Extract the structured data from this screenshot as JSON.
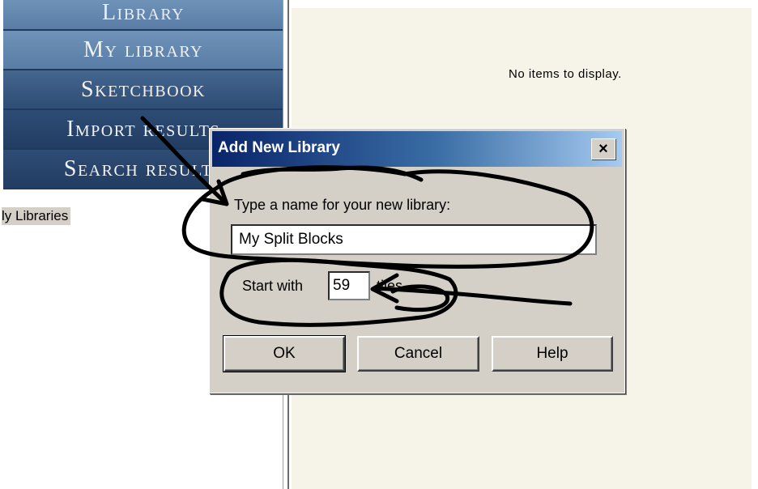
{
  "nav": {
    "items": [
      {
        "label": "Library"
      },
      {
        "label": "My library"
      },
      {
        "label": "Sketchbook"
      },
      {
        "label": "Import results"
      },
      {
        "label": "Search results"
      }
    ]
  },
  "tree": {
    "label": "ly Libraries"
  },
  "main": {
    "empty_message": "No items to display."
  },
  "dialog": {
    "title": "Add New Library",
    "close_label": "×",
    "prompt": "Type a name for your new library:",
    "name_value": "My Split Blocks",
    "start_label": "Start with",
    "start_value": "59",
    "tiles_label": "tiles.",
    "buttons": {
      "ok": "OK",
      "cancel": "Cancel",
      "help": "Help"
    }
  }
}
